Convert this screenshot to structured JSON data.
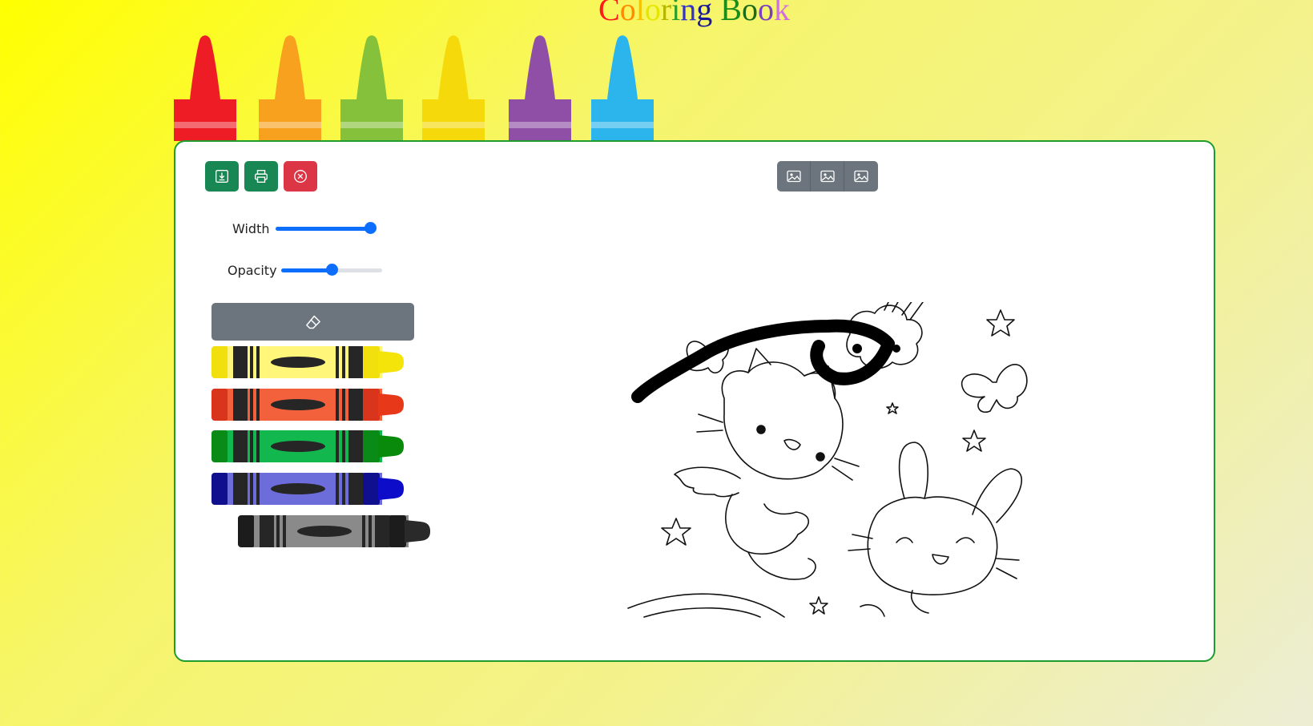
{
  "title": {
    "letters": [
      {
        "ch": "C",
        "color": "#ff1a1a"
      },
      {
        "ch": "o",
        "color": "#ff8c00"
      },
      {
        "ch": "l",
        "color": "#f5c400"
      },
      {
        "ch": "o",
        "color": "#e6e600"
      },
      {
        "ch": "r",
        "color": "#b5b500"
      },
      {
        "ch": "i",
        "color": "#2a9d2a"
      },
      {
        "ch": "n",
        "color": "#3333cc"
      },
      {
        "ch": "g",
        "color": "#1a1a99"
      },
      {
        "ch": " ",
        "color": "#000000"
      },
      {
        "ch": "B",
        "color": "#1a8c1a"
      },
      {
        "ch": "o",
        "color": "#1a6b1a"
      },
      {
        "ch": "o",
        "color": "#7a3fc2"
      },
      {
        "ch": "k",
        "color": "#d070e0"
      }
    ]
  },
  "top_crayons": [
    {
      "name": "red",
      "color": "#ee1c25"
    },
    {
      "name": "orange",
      "color": "#f7a11f"
    },
    {
      "name": "green",
      "color": "#86c13c"
    },
    {
      "name": "yellow",
      "color": "#f5d90a"
    },
    {
      "name": "purple",
      "color": "#8f4fa6"
    },
    {
      "name": "blue",
      "color": "#2bb5ec"
    }
  ],
  "toolbar": {
    "download_icon": "download-icon",
    "print_icon": "printer-icon",
    "clear_icon": "x-circle-icon"
  },
  "image_picker": {
    "buttons": [
      "image-icon",
      "image-icon",
      "image-icon"
    ]
  },
  "controls": {
    "width_label": "Width",
    "width_value": 1.0,
    "opacity_label": "Opacity",
    "opacity_value": 0.5,
    "eraser_icon": "eraser-icon"
  },
  "side_crayons": [
    {
      "name": "yellow",
      "body": "#fff67a",
      "cap": "#f2df0e",
      "tip": "#f5e40a",
      "selected": false
    },
    {
      "name": "orange-red",
      "body": "#f2603c",
      "cap": "#d9341c",
      "tip": "#e8381a",
      "selected": false
    },
    {
      "name": "green",
      "body": "#12b84e",
      "cap": "#0a8a16",
      "tip": "#0a8a0a",
      "selected": false
    },
    {
      "name": "blue",
      "body": "#6c6ddb",
      "cap": "#10108f",
      "tip": "#0c0cc9",
      "selected": false
    },
    {
      "name": "black",
      "body": "#8a8a8a",
      "cap": "#1c1c1c",
      "tip": "#2a2a2a",
      "selected": true
    }
  ],
  "colors": {
    "panel_border": "#1e9c2e",
    "primary": "#0d6efd",
    "success": "#198754",
    "danger": "#dc3545",
    "secondary": "#6c757d"
  }
}
